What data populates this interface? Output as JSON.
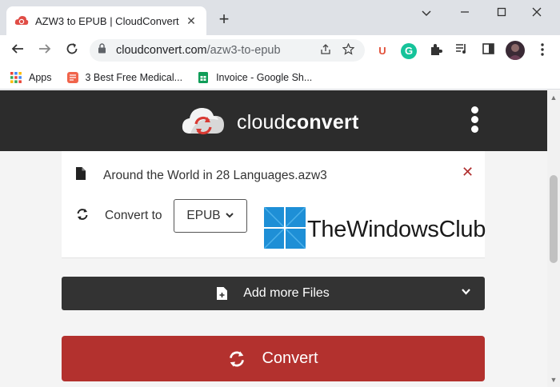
{
  "browser": {
    "tab_title": "AZW3 to EPUB | CloudConvert",
    "tab_close": "✕",
    "new_tab": "+",
    "window_controls": {
      "minimize": "⌵",
      "maximize": "—",
      "restore": "☐",
      "close": "✕"
    },
    "url_domain": "cloudconvert.com",
    "url_path": "/azw3-to-epub",
    "bookmarks": [
      {
        "label": "Apps"
      },
      {
        "label": "3 Best Free Medical..."
      },
      {
        "label": "Invoice - Google Sh..."
      }
    ],
    "extensions": [
      "U",
      "G"
    ],
    "icons": [
      "back-arrow-icon",
      "forward-arrow-icon",
      "reload-icon",
      "lock-icon",
      "share-icon",
      "star-icon",
      "puzzle-icon",
      "media-icon",
      "sidepanel-icon",
      "profile-avatar",
      "kebab-menu-icon"
    ]
  },
  "site": {
    "logo_light": "cloud",
    "logo_bold": "convert",
    "file": {
      "name": "Around the World in 28 Languages.azw3",
      "remove": "✕"
    },
    "convert_to_label": "Convert to",
    "format_value": "EPUB",
    "add_files_label": "Add more Files",
    "convert_label": "Convert",
    "accent_color": "#b3312e"
  },
  "watermark": {
    "text": "TheWindowsClub"
  }
}
